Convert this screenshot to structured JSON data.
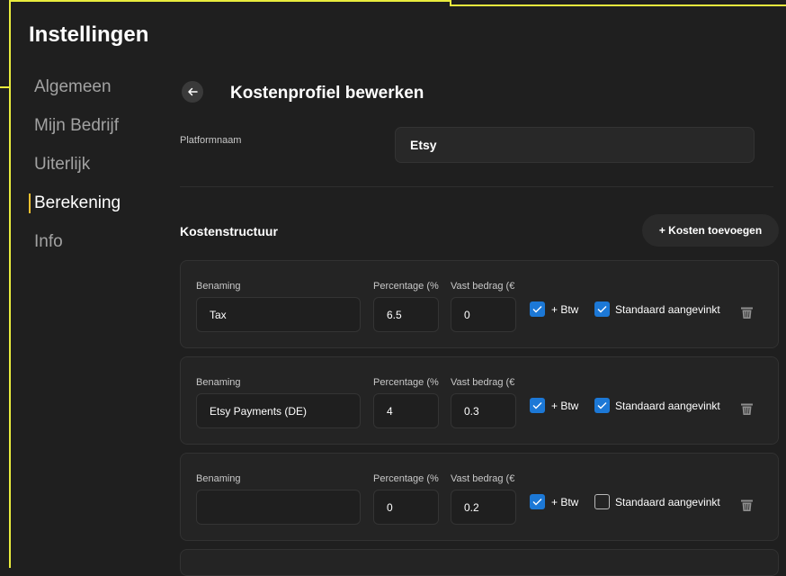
{
  "app": {
    "title": "Instellingen"
  },
  "sidebar": {
    "items": [
      {
        "label": "Algemeen"
      },
      {
        "label": "Mijn Bedrijf"
      },
      {
        "label": "Uiterlijk"
      },
      {
        "label": "Berekening",
        "active": true
      },
      {
        "label": "Info"
      }
    ]
  },
  "header": {
    "title": "Kostenprofiel bewerken",
    "back_icon": "arrow-left-icon"
  },
  "platform": {
    "label": "Platformnaam",
    "value": "Etsy"
  },
  "costs": {
    "title": "Kostenstructuur",
    "add_label": "+ Kosten toevoegen",
    "col_name": "Benaming",
    "col_pct": "Percentage (%",
    "col_fixed": "Vast bedrag (€",
    "btw_label": "+ Btw",
    "default_label": "Standaard aangevinkt",
    "rows": [
      {
        "name": "Tax",
        "pct": "6.5",
        "fixed": "0",
        "btw": true,
        "default": true
      },
      {
        "name": "Etsy Payments (DE)",
        "pct": "4",
        "fixed": "0.3",
        "btw": true,
        "default": true
      },
      {
        "name": "",
        "pct": "0",
        "fixed": "0.2",
        "btw": true,
        "default": false
      }
    ]
  },
  "colors": {
    "accent": "#1c78d6",
    "active_indicator": "#f2c230",
    "frame": "#e9ec3d"
  }
}
